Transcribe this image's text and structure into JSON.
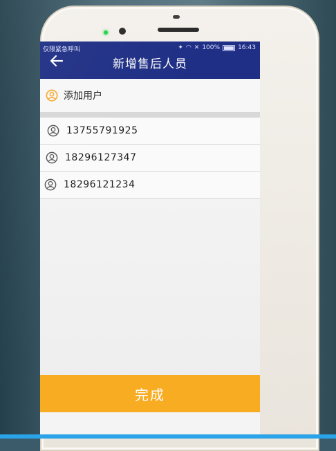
{
  "status_bar": {
    "left_text": "仅限紧急呼叫",
    "battery": "100%",
    "time": "16:43",
    "battery_level": 1.0
  },
  "header": {
    "title": "新增售后人员",
    "back_icon": "arrow-left-icon"
  },
  "add_user": {
    "label": "添加用户",
    "icon": "user-circle-icon",
    "icon_color": "#f5a623"
  },
  "users": [
    {
      "phone": "13755791925",
      "icon": "user-circle-icon"
    },
    {
      "phone": "18296127347",
      "icon": "user-circle-icon"
    },
    {
      "phone": "18296121234",
      "icon": "user-circle-icon"
    }
  ],
  "footer": {
    "done_label": "完成"
  },
  "colors": {
    "appbar": "#1f2f85",
    "accent": "#f8ac22",
    "user_icon": "#555555"
  }
}
